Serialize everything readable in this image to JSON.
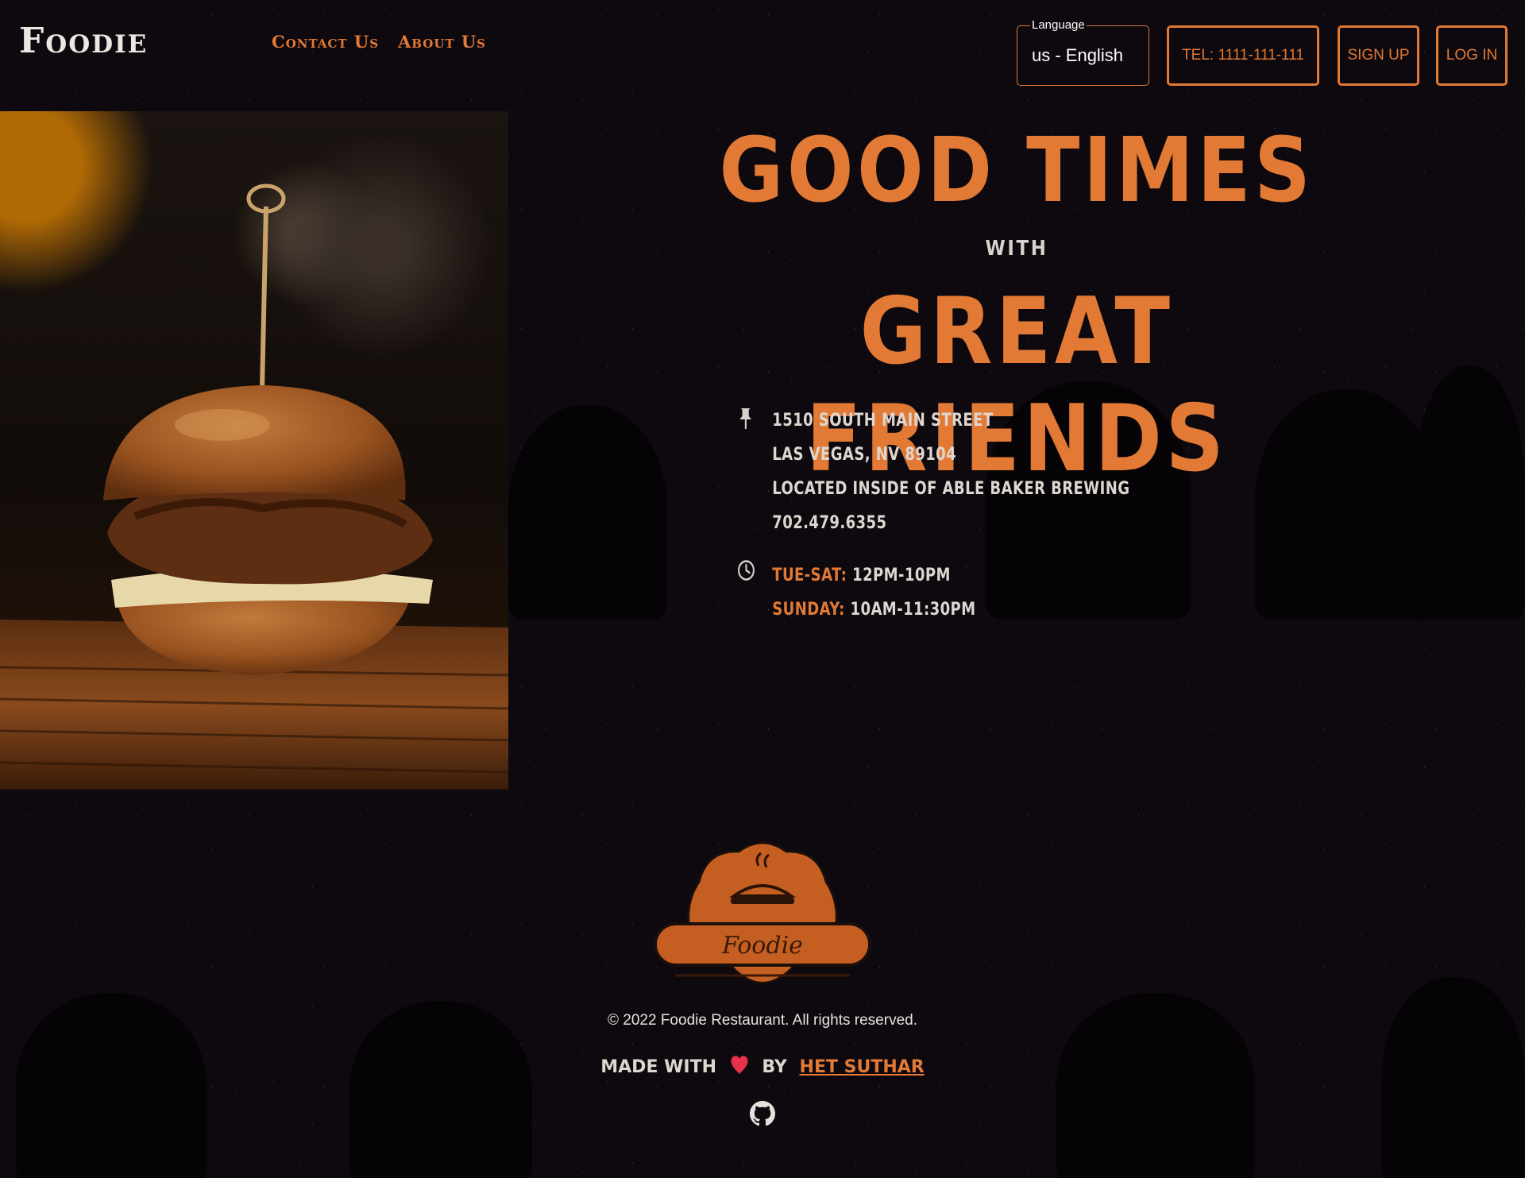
{
  "header": {
    "logo": "Foodie",
    "nav": [
      {
        "label": "Contact Us"
      },
      {
        "label": "About Us"
      }
    ],
    "language": {
      "legend": "Language",
      "value": "us - English"
    },
    "tel_label": "TEL: 1111-111-111",
    "signup_label": "SIGN UP",
    "login_label": "LOG IN"
  },
  "hero": {
    "line1": "GOOD TIMES",
    "line2": "WITH",
    "line3": "GREAT FRIENDS",
    "address": [
      "1510 SOUTH MAIN STREET",
      "LAS VEGAS, NV 89104",
      "LOCATED INSIDE OF ABLE BAKER BREWING",
      "702.479.6355"
    ],
    "hours": [
      {
        "day": "TUE-SAT:",
        "time": "12PM-10PM"
      },
      {
        "day": "SUNDAY:",
        "time": "10AM-11:30PM"
      }
    ]
  },
  "footer": {
    "logo_text": "Foodie",
    "copyright": "© 2022 Foodie Restaurant. All rights reserved.",
    "made_with": "MADE WITH",
    "by": "BY",
    "author": "HET SUTHAR"
  },
  "icons": {
    "address": "pin-icon",
    "hours": "clock-icon",
    "heart": "heart-icon",
    "social": "github-icon"
  },
  "colors": {
    "accent": "#e27a35",
    "background": "#0e090f",
    "text": "#e6e1dc",
    "heart": "#e8314a"
  }
}
